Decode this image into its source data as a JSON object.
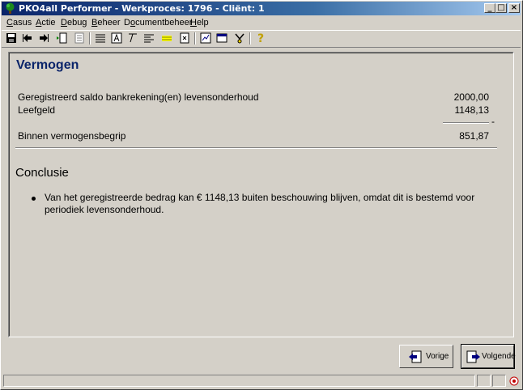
{
  "window": {
    "title": "PKO4all Performer - Werkproces: 1796 - Cliënt: 1",
    "controls": {
      "minimize": "_",
      "maximize": "□",
      "close": "×"
    }
  },
  "menu": [
    {
      "label": "Casus",
      "accel": "C"
    },
    {
      "label": "Actie",
      "accel": "A"
    },
    {
      "label": "Debug",
      "accel": "D"
    },
    {
      "label": "Beheer",
      "accel": "B"
    },
    {
      "label": "Documentbeheer",
      "accel": "o"
    },
    {
      "label": "Help",
      "accel": "H"
    }
  ],
  "toolbar": {
    "icons": [
      "save-icon",
      "back-icon",
      "forward-icon",
      "document-insert-icon",
      "list-icon",
      "numbered-list-icon",
      "text-box-icon",
      "format-icon",
      "align-left-icon",
      "highlight-icon",
      "page-icon",
      "chart-icon",
      "window-icon",
      "tools-icon",
      "help-icon"
    ]
  },
  "main": {
    "heading": "Vermogen",
    "rows": [
      {
        "label": "Geregistreerd saldo bankrekening(en) levensonderhoud",
        "value": "2000,00"
      },
      {
        "label": "Leefgeld",
        "value": "1148,13"
      }
    ],
    "operator": "-",
    "total": {
      "label": "Binnen vermogensbegrip",
      "value": "851,87"
    },
    "conclusion_heading": "Conclusie",
    "conclusion_bullets": [
      "Van het geregistreerde bedrag kan € 1148,13 buiten beschouwing blijven, omdat dit is bestemd voor periodiek levensonderhoud."
    ]
  },
  "navigation": {
    "previous_label": "Vorige",
    "next_label": "Volgende"
  },
  "colors": {
    "heading": "#0a246a",
    "title_bar": "#0a246a",
    "face": "#d4d0c8"
  }
}
